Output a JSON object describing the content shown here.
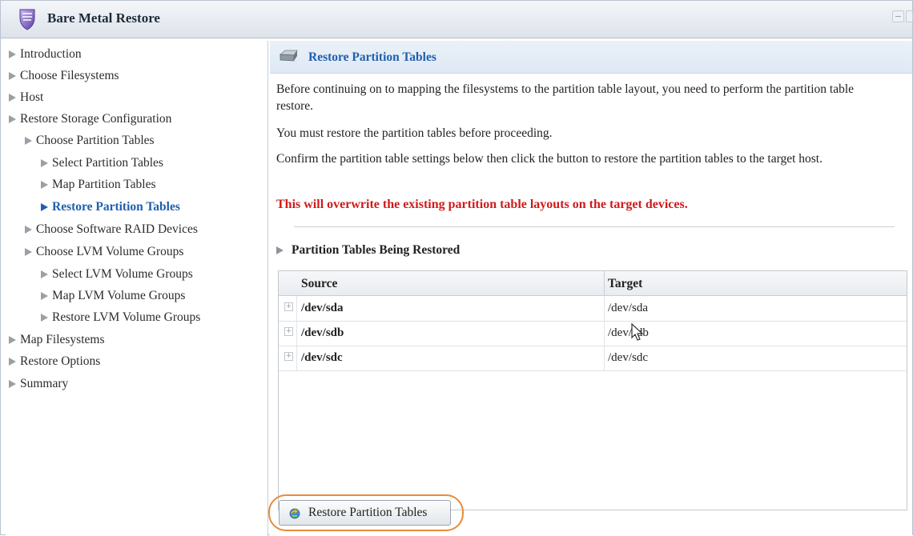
{
  "window": {
    "title": "Bare Metal Restore"
  },
  "sidebar": {
    "items": [
      {
        "label": "Introduction",
        "level": 0,
        "active": false
      },
      {
        "label": "Choose Filesystems",
        "level": 0,
        "active": false
      },
      {
        "label": "Host",
        "level": 0,
        "active": false
      },
      {
        "label": "Restore Storage Configuration",
        "level": 0,
        "active": false
      },
      {
        "label": "Choose Partition Tables",
        "level": 1,
        "active": false
      },
      {
        "label": "Select Partition Tables",
        "level": 2,
        "active": false
      },
      {
        "label": "Map Partition Tables",
        "level": 2,
        "active": false
      },
      {
        "label": "Restore Partition Tables",
        "level": 2,
        "active": true
      },
      {
        "label": "Choose Software RAID Devices",
        "level": 1,
        "active": false
      },
      {
        "label": "Choose LVM Volume Groups",
        "level": 1,
        "active": false
      },
      {
        "label": "Select LVM Volume Groups",
        "level": 2,
        "active": false
      },
      {
        "label": "Map LVM Volume Groups",
        "level": 2,
        "active": false
      },
      {
        "label": "Restore LVM Volume Groups",
        "level": 2,
        "active": false
      },
      {
        "label": "Map Filesystems",
        "level": 0,
        "active": false
      },
      {
        "label": "Restore Options",
        "level": 0,
        "active": false
      },
      {
        "label": "Summary",
        "level": 0,
        "active": false
      }
    ]
  },
  "main": {
    "title": "Restore Partition Tables",
    "para1": "Before continuing on to mapping the filesystems to the partition table layout, you need to perform the partition table restore.",
    "para2": "You must restore the partition tables before proceeding.",
    "para3": "Confirm the partition table settings below then click the button to restore the partition tables to the target host.",
    "warning": "This will overwrite the existing partition table layouts on the target devices.",
    "section_title": "Partition Tables Being Restored",
    "table": {
      "columns": [
        "Source",
        "Target"
      ],
      "rows": [
        {
          "source": "/dev/sda",
          "target": "/dev/sda"
        },
        {
          "source": "/dev/sdb",
          "target": "/dev/sdb"
        },
        {
          "source": "/dev/sdc",
          "target": "/dev/sdc"
        }
      ]
    },
    "restore_button_label": "Restore Partition Tables"
  },
  "colors": {
    "accent": "#1f5fae",
    "warning": "#d11a1a",
    "highlight_ring": "#e98b3a"
  },
  "icons": {
    "app": "shield-icon",
    "header": "disk-icon",
    "button": "restore-icon",
    "expander": "plus-icon",
    "pointer": "mouse-cursor-icon"
  }
}
